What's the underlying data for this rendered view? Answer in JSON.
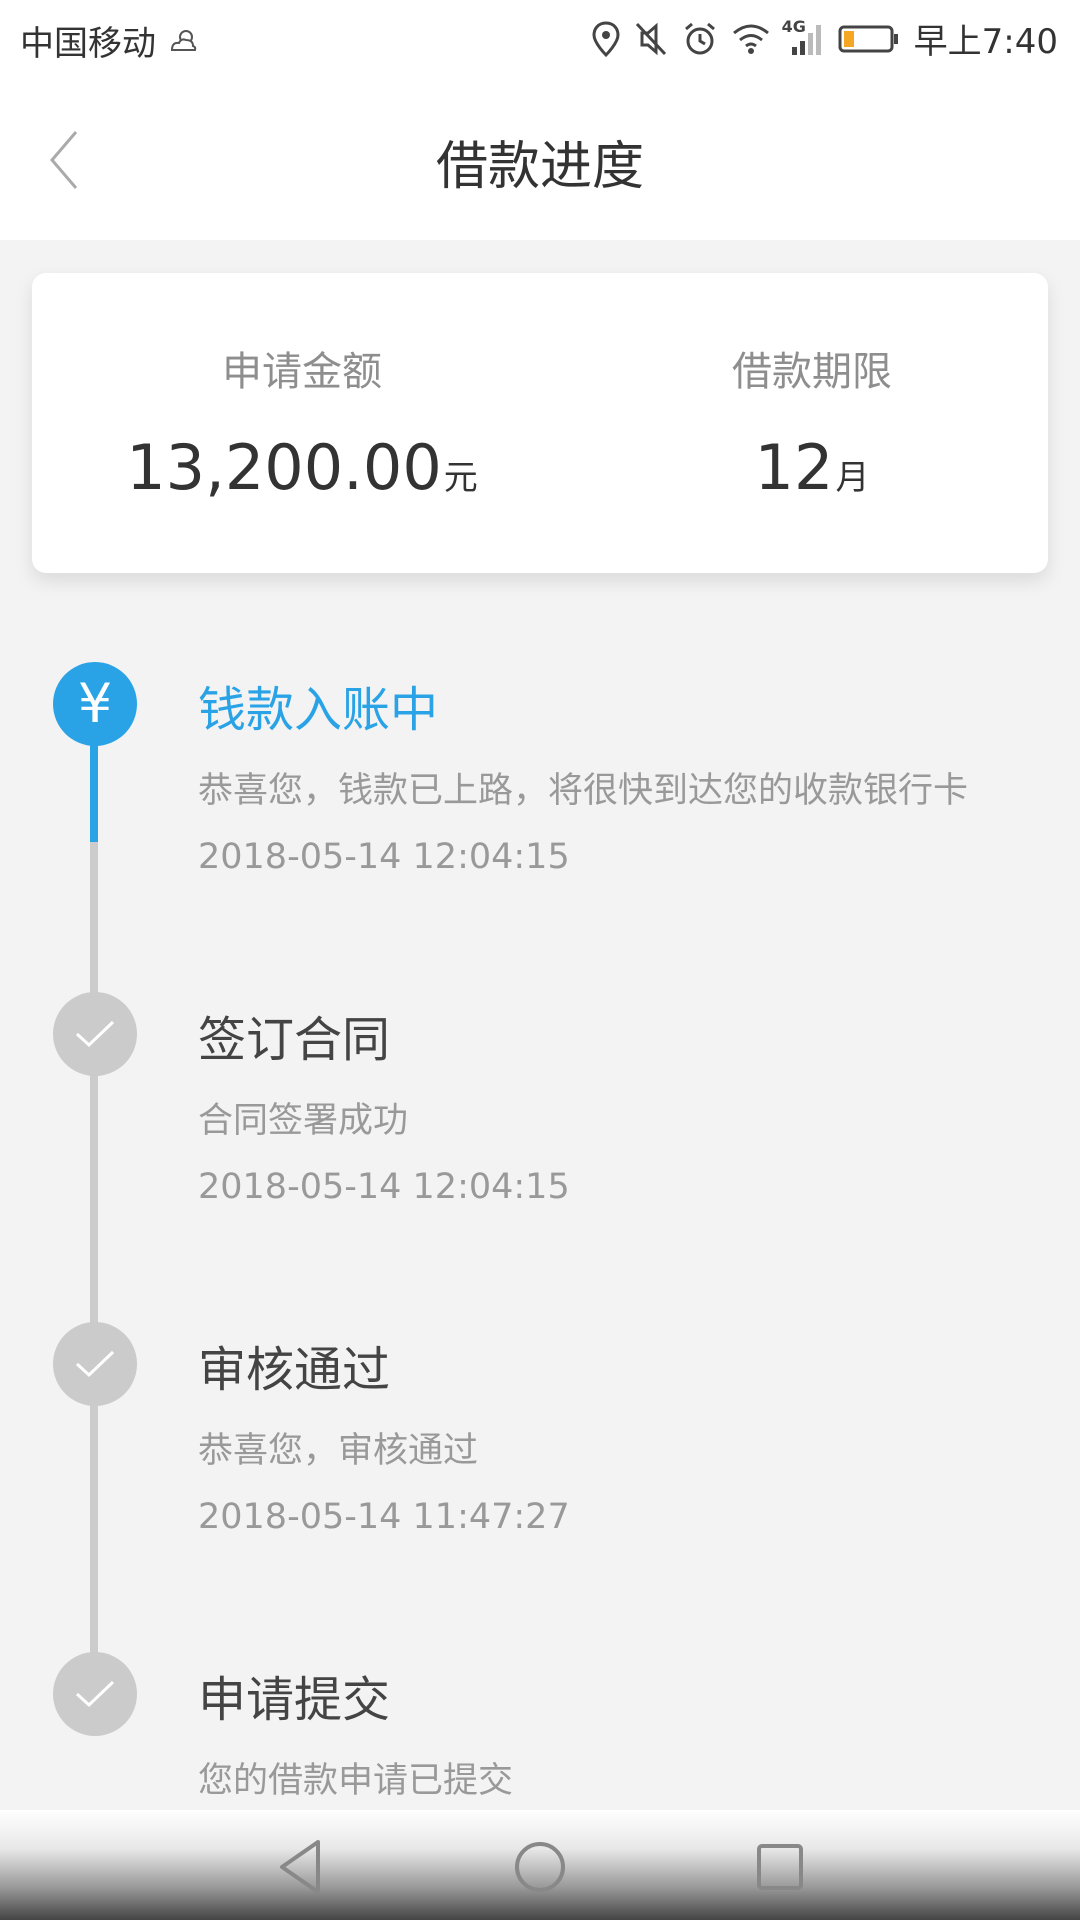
{
  "status_bar": {
    "carrier": "中国移动",
    "network": "4G",
    "time": "早上7:40",
    "battery_color": "#f5a623"
  },
  "header": {
    "title": "借款进度"
  },
  "summary": {
    "amount_label": "申请金额",
    "amount_value": "13,200.00",
    "amount_unit": "元",
    "term_label": "借款期限",
    "term_value": "12",
    "term_unit": "月"
  },
  "timeline": {
    "accent_color": "#2aa3e6",
    "steps": [
      {
        "title": "钱款入账中",
        "desc": "恭喜您，钱款已上路，将很快到达您的收款银行卡",
        "time": "2018-05-14 12:04:15",
        "state": "active",
        "icon": "yen-icon",
        "icon_glyph": "¥"
      },
      {
        "title": "签订合同",
        "desc": "合同签署成功",
        "time": "2018-05-14 12:04:15",
        "state": "done",
        "icon": "check-icon"
      },
      {
        "title": "审核通过",
        "desc": "恭喜您，审核通过",
        "time": "2018-05-14 11:47:27",
        "state": "done",
        "icon": "check-icon"
      },
      {
        "title": "申请提交",
        "desc": "您的借款申请已提交",
        "state": "done",
        "icon": "check-icon"
      }
    ]
  }
}
